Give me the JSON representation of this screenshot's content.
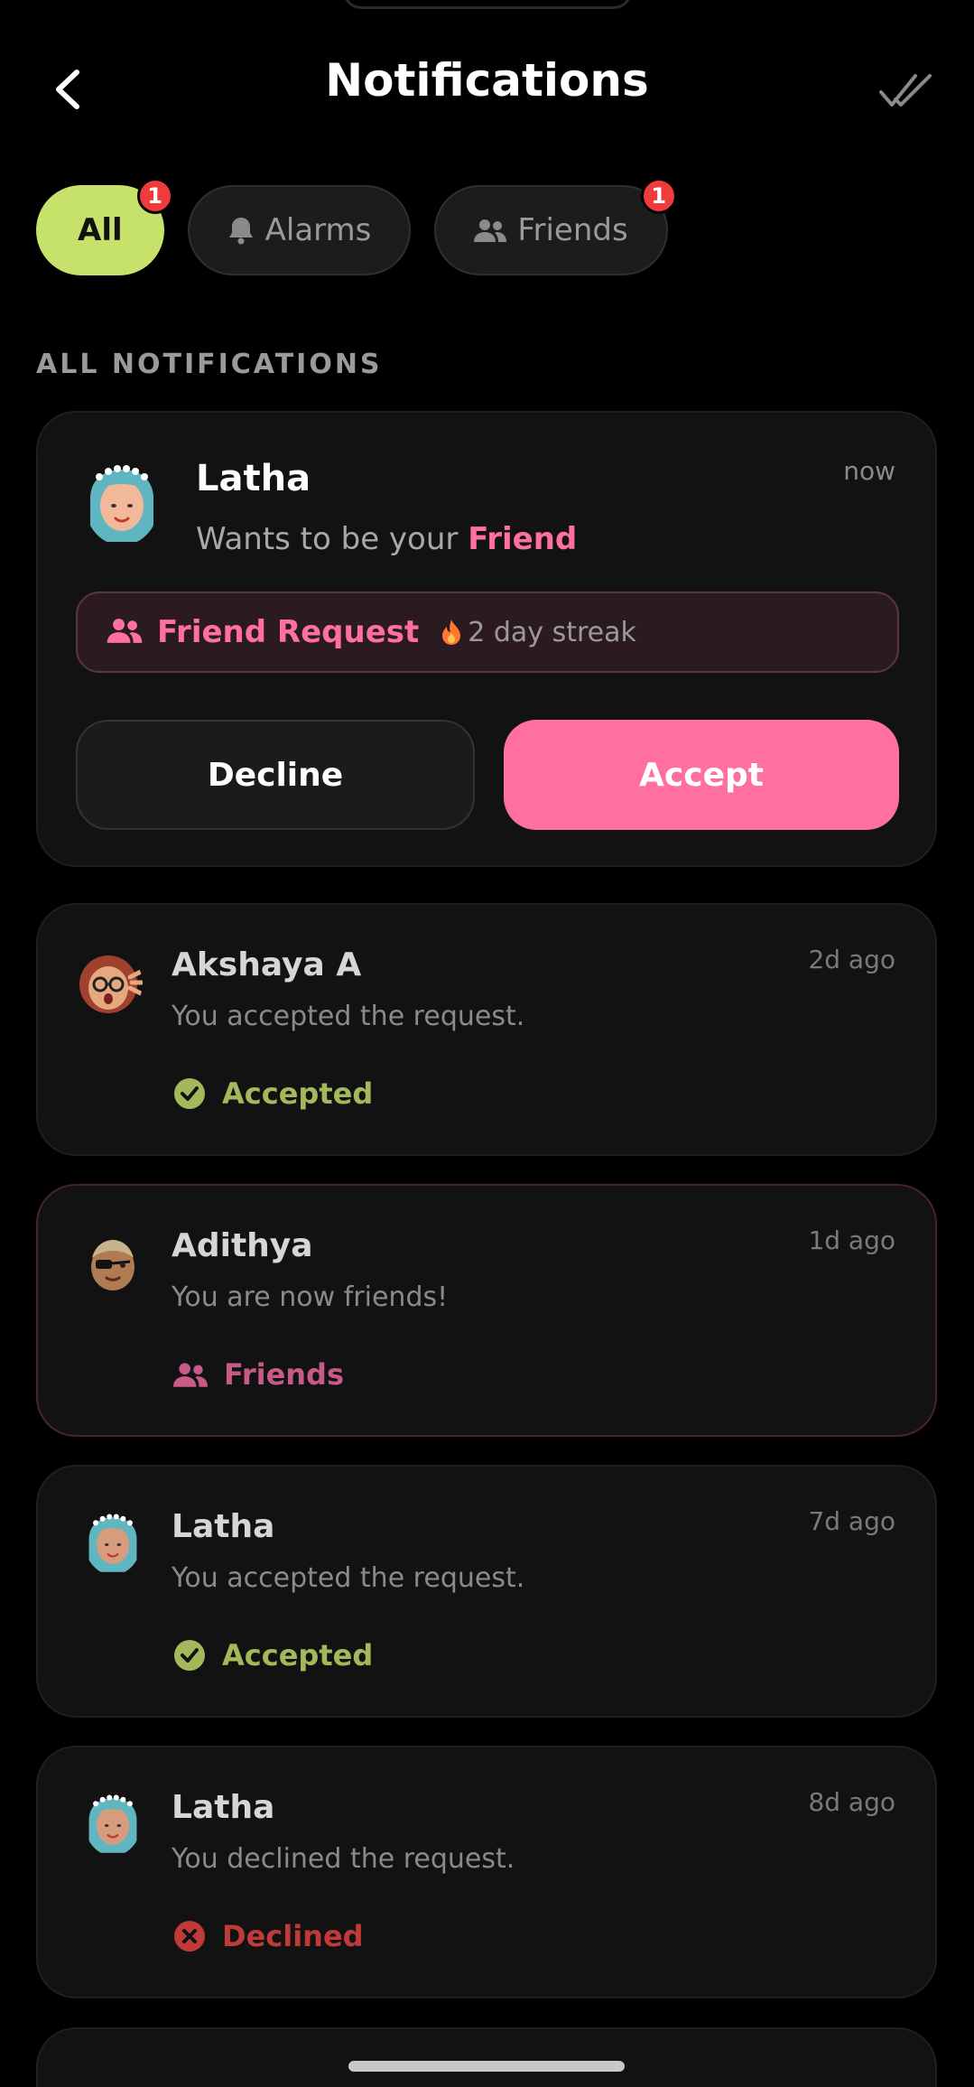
{
  "header": {
    "title": "Notifications",
    "back_icon": "chevron-left-icon",
    "mark_all_read_icon": "double-check-icon"
  },
  "filters": [
    {
      "label": "All",
      "active": true,
      "badge": "1"
    },
    {
      "label": "Alarms",
      "icon": "bell-icon",
      "active": false,
      "badge": ""
    },
    {
      "label": "Friends",
      "icon": "people-icon",
      "active": false,
      "badge": "1"
    }
  ],
  "section_title": "ALL NOTIFICATIONS",
  "pending": {
    "name": "Latha",
    "time": "now",
    "message_prefix": "Wants to be your ",
    "message_highlight": "Friend",
    "request_label": "Friend Request",
    "streak_text": "2 day streak",
    "decline_label": "Decline",
    "accept_label": "Accept"
  },
  "history": [
    {
      "name": "Akshaya A",
      "time": "2d ago",
      "message": "You accepted the request.",
      "status": "Accepted",
      "status_type": "accepted"
    },
    {
      "name": "Adithya",
      "time": "1d ago",
      "message": "You are now friends!",
      "status": "Friends",
      "status_type": "friends"
    },
    {
      "name": "Latha",
      "time": "7d ago",
      "message": "You accepted the request.",
      "status": "Accepted",
      "status_type": "accepted"
    },
    {
      "name": "Latha",
      "time": "8d ago",
      "message": "You declined the request.",
      "status": "Declined",
      "status_type": "declined"
    }
  ],
  "colors": {
    "accent_lime": "#c7e26a",
    "accent_pink": "#ff6fa0",
    "accepted_green": "#a3b85a",
    "declined_red": "#c03a3a",
    "badge_red": "#ef3b3b"
  }
}
